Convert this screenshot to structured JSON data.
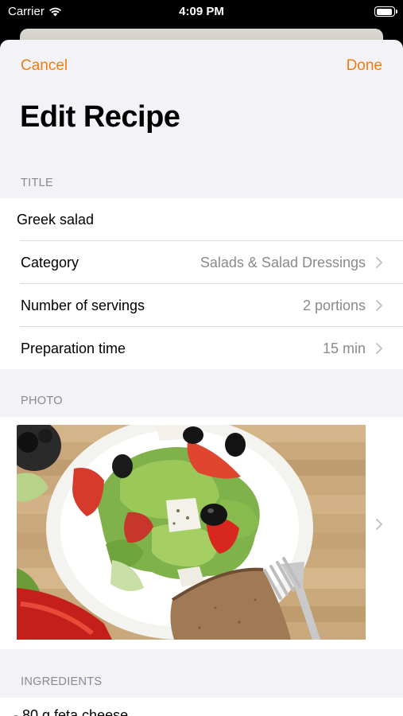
{
  "status_bar": {
    "carrier": "Carrier",
    "time": "4:09 PM"
  },
  "nav": {
    "cancel_label": "Cancel",
    "done_label": "Done"
  },
  "page_title": "Edit Recipe",
  "sections": {
    "title_header": "TITLE",
    "photo_header": "PHOTO",
    "ingredients_header": "INGREDIENTS"
  },
  "recipe": {
    "title": "Greek salad",
    "rows": [
      {
        "label": "Category",
        "value": "Salads & Salad Dressings"
      },
      {
        "label": "Number of servings",
        "value": "2 portions"
      },
      {
        "label": "Preparation time",
        "value": "15 min"
      }
    ],
    "photo_description": "Greek salad on a white plate with rye bread and fork",
    "ingredients": [
      "- 80 g feta cheese"
    ]
  },
  "colors": {
    "accent": "#f27d0c",
    "secondary_text": "#8a8a8e",
    "background": "#f2f2f7"
  }
}
